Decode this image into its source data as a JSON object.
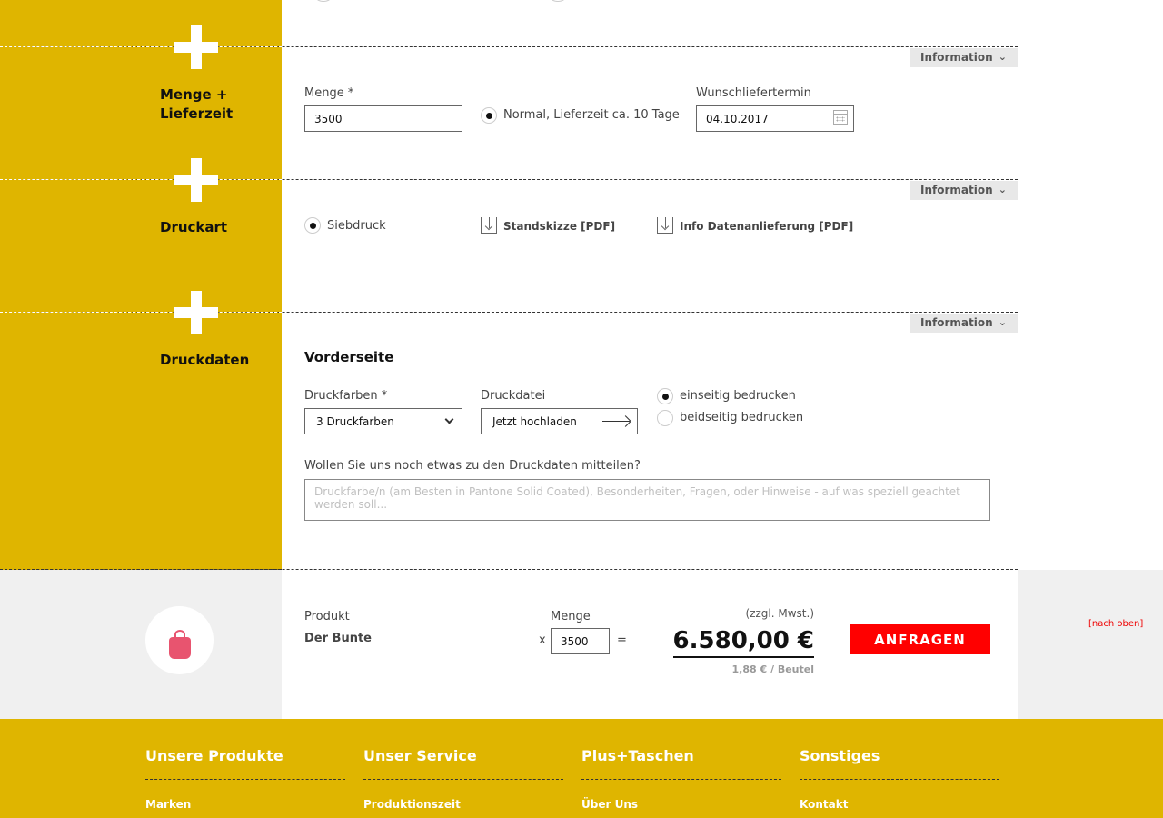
{
  "sections": {
    "menge": {
      "title_line1": "Menge +",
      "title_line2": "Lieferzeit",
      "info_label": "Information",
      "menge_label": "Menge *",
      "menge_value": "3500",
      "delivery_option": "Normal, Lieferzeit ca. 10 Tage",
      "wunsch_label": "Wunschliefertermin",
      "wunsch_value": "04.10.2017"
    },
    "druckart": {
      "title": "Druckart",
      "info_label": "Information",
      "option": "Siebdruck",
      "download1": "Standskizze [PDF]",
      "download2": "Info Datenanlieferung [PDF]"
    },
    "druckdaten": {
      "title": "Druckdaten",
      "info_label": "Information",
      "subheading": "Vorderseite",
      "farben_label": "Druckfarben *",
      "farben_value": "3 Druckfarben",
      "datei_label": "Druckdatei",
      "upload_label": "Jetzt hochladen",
      "radio1": "einseitig bedrucken",
      "radio2": "beidseitig bedrucken",
      "message_label": "Wollen Sie uns noch etwas zu den Druckdaten mitteilen?",
      "message_placeholder": "Druckfarbe/n (am Besten in Pantone Solid Coated), Besonderheiten, Fragen, oder Hinweise - auf was speziell geachtet werden soll..."
    }
  },
  "summary": {
    "product_label": "Produkt",
    "product_name": "Der Bunte",
    "x": "x",
    "menge_label": "Menge",
    "menge_value": "3500",
    "equals": "=",
    "tax_note": "(zzgl. Mwst.)",
    "price": "6.580,00 €",
    "unit_price": "1,88 € / Beutel",
    "button": "ANFRAGEN",
    "back_to_top": "[nach oben]"
  },
  "footer": {
    "columns": [
      {
        "title": "Unsere Produkte",
        "link": "Marken"
      },
      {
        "title": "Unser Service",
        "link": "Produktionszeit"
      },
      {
        "title": "Plus+Taschen",
        "link": "Über Uns"
      },
      {
        "title": "Sonstiges",
        "link": "Kontakt"
      }
    ]
  },
  "colors": {
    "brand_yellow": "#dfb500",
    "accent_red": "#ff0000",
    "summary_bg": "#f0f0f0"
  }
}
